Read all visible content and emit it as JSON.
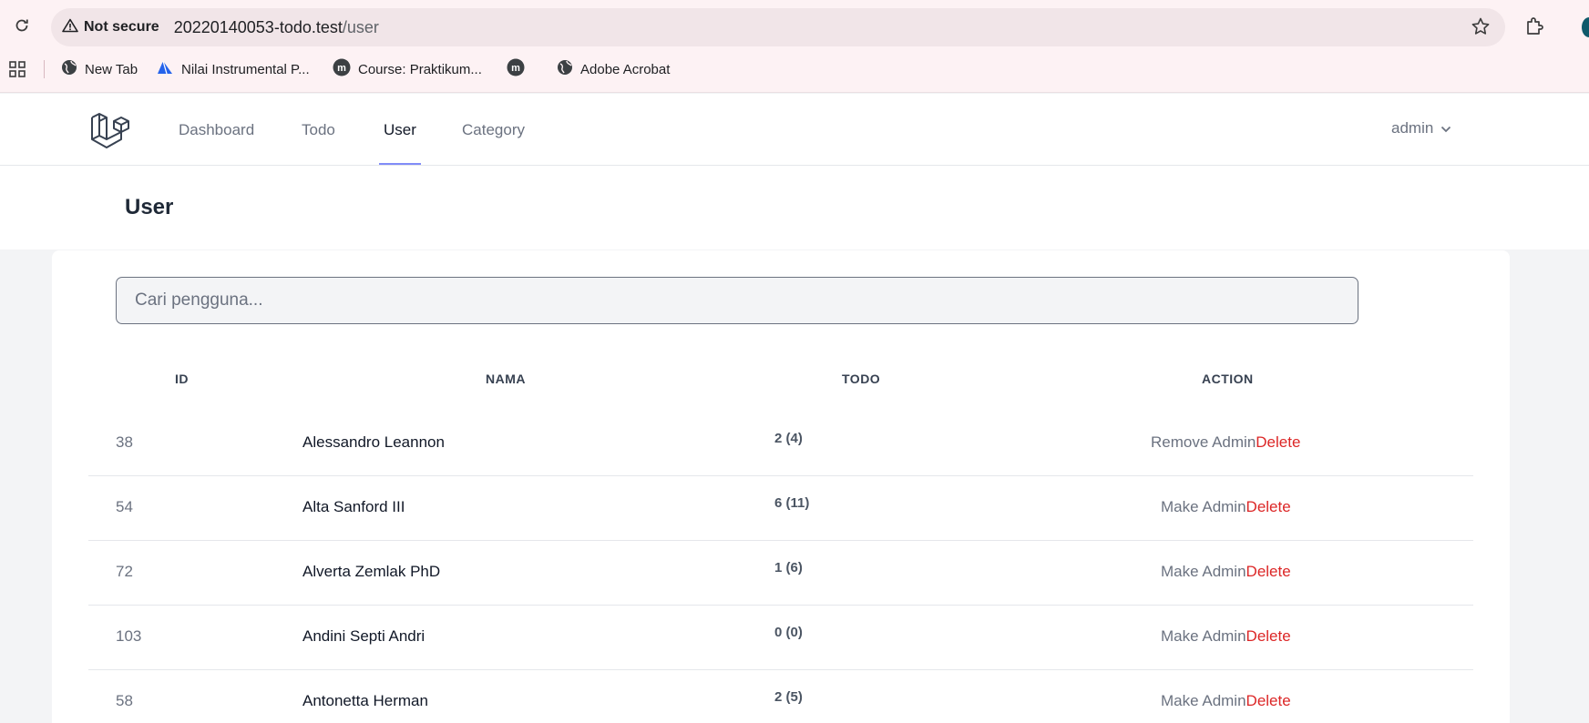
{
  "browser": {
    "security_label": "Not secure",
    "url_host": "20220140053-todo.test",
    "url_path": "/user",
    "bookmarks": [
      {
        "label": "New Tab",
        "icon": "globe-icon"
      },
      {
        "label": "Nilai Instrumental P...",
        "icon": "triangle-app-icon"
      },
      {
        "label": "Course: Praktikum...",
        "icon": "moodle-icon"
      },
      {
        "label": "",
        "icon": "moodle-icon"
      },
      {
        "label": "Adobe Acrobat",
        "icon": "globe-icon"
      }
    ]
  },
  "nav": {
    "links": [
      "Dashboard",
      "Todo",
      "User",
      "Category"
    ],
    "active": "User",
    "user_name": "admin"
  },
  "page": {
    "title": "User"
  },
  "search": {
    "placeholder": "Cari pengguna..."
  },
  "table": {
    "headers": {
      "id": "ID",
      "name": "NAMA",
      "todo": "TODO",
      "action": "ACTION"
    },
    "rows": [
      {
        "id": "38",
        "name": "Alessandro Leannon",
        "todo": "2 (4)",
        "admin_action": "Remove Admin",
        "delete": "Delete"
      },
      {
        "id": "54",
        "name": "Alta Sanford III",
        "todo": "6 (11)",
        "admin_action": "Make Admin",
        "delete": "Delete"
      },
      {
        "id": "72",
        "name": "Alverta Zemlak PhD",
        "todo": "1 (6)",
        "admin_action": "Make Admin",
        "delete": "Delete"
      },
      {
        "id": "103",
        "name": "Andini Septi Andri",
        "todo": "0 (0)",
        "admin_action": "Make Admin",
        "delete": "Delete"
      },
      {
        "id": "58",
        "name": "Antonetta Herman",
        "todo": "2 (5)",
        "admin_action": "Make Admin",
        "delete": "Delete"
      }
    ]
  },
  "colors": {
    "delete": "#dc2626",
    "active_underline": "#818cf8",
    "browser_bg": "#fdf2f4"
  }
}
